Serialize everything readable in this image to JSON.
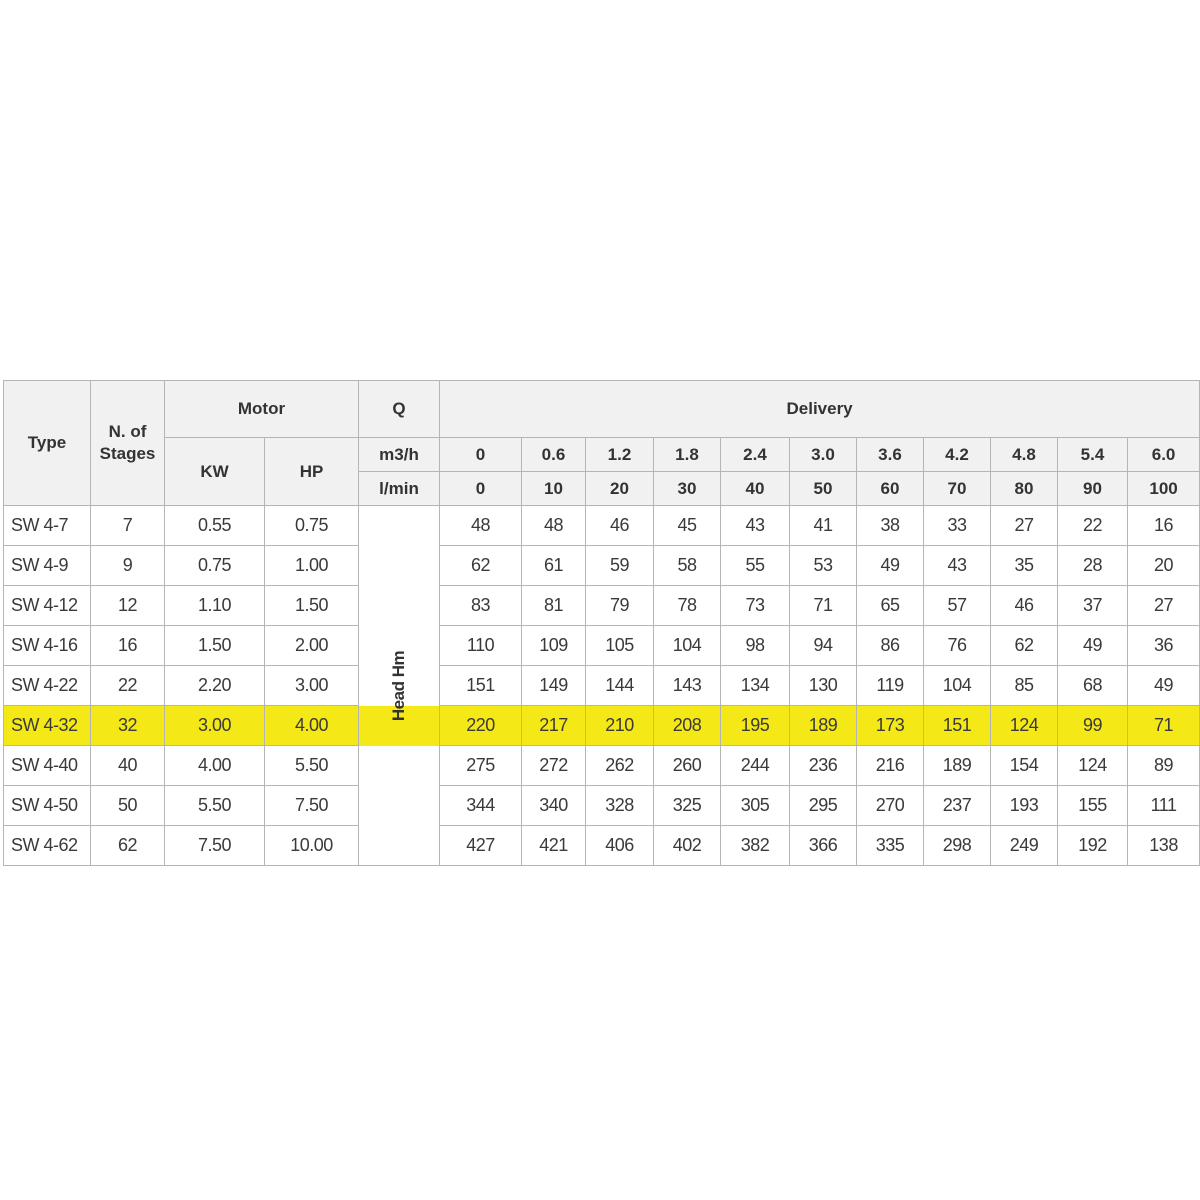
{
  "headers": {
    "type": "Type",
    "stages_line1": "N. of",
    "stages_line2": "Stages",
    "motor": "Motor",
    "kw": "KW",
    "hp": "HP",
    "q": "Q",
    "delivery": "Delivery",
    "m3h_unit": "m3/h",
    "lmin_unit": "l/min",
    "head": "Head Hm"
  },
  "delivery_m3h": [
    "0",
    "0.6",
    "1.2",
    "1.8",
    "2.4",
    "3.0",
    "3.6",
    "4.2",
    "4.8",
    "5.4",
    "6.0"
  ],
  "delivery_lmin": [
    "0",
    "10",
    "20",
    "30",
    "40",
    "50",
    "60",
    "70",
    "80",
    "90",
    "100"
  ],
  "highlight_color": "#f5e817",
  "rows": [
    {
      "type": "SW   4-7",
      "stages": "7",
      "kw": "0.55",
      "hp": "0.75",
      "head": [
        "48",
        "48",
        "46",
        "45",
        "43",
        "41",
        "38",
        "33",
        "27",
        "22",
        "16"
      ],
      "highlighted": false
    },
    {
      "type": "SW   4-9",
      "stages": "9",
      "kw": "0.75",
      "hp": "1.00",
      "head": [
        "62",
        "61",
        "59",
        "58",
        "55",
        "53",
        "49",
        "43",
        "35",
        "28",
        "20"
      ],
      "highlighted": false
    },
    {
      "type": "SW 4-12",
      "stages": "12",
      "kw": "1.10",
      "hp": "1.50",
      "head": [
        "83",
        "81",
        "79",
        "78",
        "73",
        "71",
        "65",
        "57",
        "46",
        "37",
        "27"
      ],
      "highlighted": false
    },
    {
      "type": "SW 4-16",
      "stages": "16",
      "kw": "1.50",
      "hp": "2.00",
      "head": [
        "110",
        "109",
        "105",
        "104",
        "98",
        "94",
        "86",
        "76",
        "62",
        "49",
        "36"
      ],
      "highlighted": false
    },
    {
      "type": "SW 4-22",
      "stages": "22",
      "kw": "2.20",
      "hp": "3.00",
      "head": [
        "151",
        "149",
        "144",
        "143",
        "134",
        "130",
        "119",
        "104",
        "85",
        "68",
        "49"
      ],
      "highlighted": false
    },
    {
      "type": "SW 4-32",
      "stages": "32",
      "kw": "3.00",
      "hp": "4.00",
      "head": [
        "220",
        "217",
        "210",
        "208",
        "195",
        "189",
        "173",
        "151",
        "124",
        "99",
        "71"
      ],
      "highlighted": true
    },
    {
      "type": "SW 4-40",
      "stages": "40",
      "kw": "4.00",
      "hp": "5.50",
      "head": [
        "275",
        "272",
        "262",
        "260",
        "244",
        "236",
        "216",
        "189",
        "154",
        "124",
        "89"
      ],
      "highlighted": false
    },
    {
      "type": "SW 4-50",
      "stages": "50",
      "kw": "5.50",
      "hp": "7.50",
      "head": [
        "344",
        "340",
        "328",
        "325",
        "305",
        "295",
        "270",
        "237",
        "193",
        "155",
        "111"
      ],
      "highlighted": false
    },
    {
      "type": "SW 4-62",
      "stages": "62",
      "kw": "7.50",
      "hp": "10.00",
      "head": [
        "427",
        "421",
        "406",
        "402",
        "382",
        "366",
        "335",
        "298",
        "249",
        "192",
        "138"
      ],
      "highlighted": false
    }
  ]
}
